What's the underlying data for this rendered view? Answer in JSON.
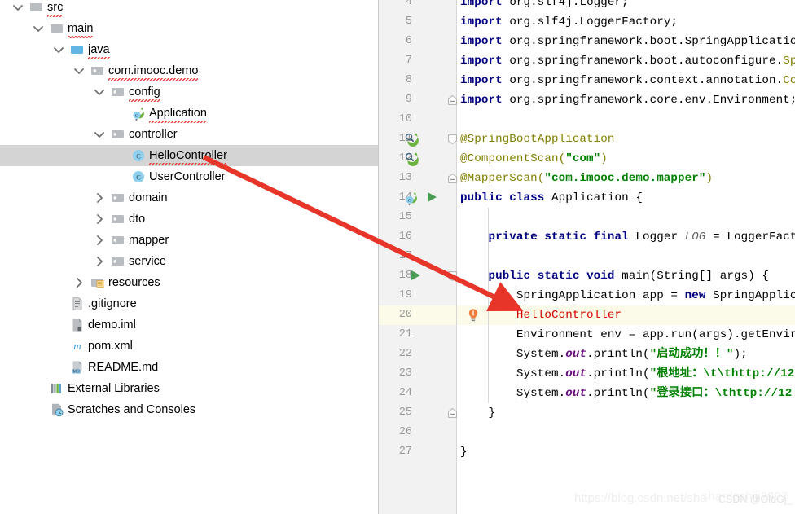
{
  "app": {
    "name": "IntelliJ IDEA",
    "view": "project-tree-and-editor"
  },
  "colors": {
    "selection": "#d4d4d4",
    "line_highlight": "#fcfae8",
    "arrow": "#e8352a",
    "keyword": "#000080",
    "annotation": "#808000",
    "string": "#008000",
    "field": "#660e7a",
    "error": "#d40000",
    "gutter_bg": "#f2f2f2",
    "line_number": "#999999",
    "spring_bean": "#6cb33f",
    "run_arrow": "#499c54",
    "folder": "#afb1b3",
    "java_folder": "#62b5e5",
    "class_icon": "#89c6e8",
    "bulb": "#e8a33d"
  },
  "tree": {
    "selected_item": "HelloController",
    "items": [
      {
        "label": "src",
        "indent": 0,
        "twisty": "down",
        "icon": "folder-plain-icon",
        "typo": true,
        "selected": false
      },
      {
        "label": "main",
        "indent": 1,
        "twisty": "down",
        "icon": "folder-plain-icon",
        "typo": true,
        "selected": false
      },
      {
        "label": "java",
        "indent": 2,
        "twisty": "down",
        "icon": "folder-java-icon",
        "typo": true,
        "selected": false
      },
      {
        "label": "com.imooc.demo",
        "indent": 3,
        "twisty": "down",
        "icon": "folder-package-icon",
        "typo": true,
        "selected": false
      },
      {
        "label": "config",
        "indent": 4,
        "twisty": "down",
        "icon": "folder-package-icon",
        "typo": true,
        "selected": false
      },
      {
        "label": "Application",
        "indent": 5,
        "twisty": "none",
        "icon": "spring-class-icon",
        "typo": true,
        "selected": false
      },
      {
        "label": "controller",
        "indent": 4,
        "twisty": "down",
        "icon": "folder-package-icon",
        "typo": false,
        "selected": false
      },
      {
        "label": "HelloController",
        "indent": 5,
        "twisty": "none",
        "icon": "class-icon",
        "typo": true,
        "selected": true
      },
      {
        "label": "UserController",
        "indent": 5,
        "twisty": "none",
        "icon": "class-icon",
        "typo": false,
        "selected": false
      },
      {
        "label": "domain",
        "indent": 4,
        "twisty": "right",
        "icon": "folder-package-icon",
        "typo": false,
        "selected": false
      },
      {
        "label": "dto",
        "indent": 4,
        "twisty": "right",
        "icon": "folder-package-icon",
        "typo": false,
        "selected": false
      },
      {
        "label": "mapper",
        "indent": 4,
        "twisty": "right",
        "icon": "folder-package-icon",
        "typo": false,
        "selected": false
      },
      {
        "label": "service",
        "indent": 4,
        "twisty": "right",
        "icon": "folder-package-icon",
        "typo": false,
        "selected": false
      },
      {
        "label": "resources",
        "indent": 3,
        "twisty": "right",
        "icon": "folder-resources-icon",
        "typo": false,
        "selected": false
      },
      {
        "label": ".gitignore",
        "indent": 2,
        "twisty": "none",
        "icon": "file-text-icon",
        "typo": false,
        "selected": false
      },
      {
        "label": "demo.iml",
        "indent": 2,
        "twisty": "none",
        "icon": "file-iml-icon",
        "typo": false,
        "selected": false
      },
      {
        "label": "pom.xml",
        "indent": 2,
        "twisty": "none",
        "icon": "maven-icon",
        "typo": false,
        "selected": false
      },
      {
        "label": "README.md",
        "indent": 2,
        "twisty": "none",
        "icon": "file-markdown-icon",
        "typo": false,
        "selected": false
      },
      {
        "label": "External Libraries",
        "indent": 1,
        "twisty": "none",
        "icon": "libraries-icon",
        "typo": false,
        "selected": false
      },
      {
        "label": "Scratches and Consoles",
        "indent": 1,
        "twisty": "none",
        "icon": "scratches-icon",
        "typo": false,
        "selected": false
      }
    ]
  },
  "editor": {
    "first_visible_line": 4,
    "last_visible_line": 27,
    "highlighted_line": 20,
    "lines": [
      {
        "n": 4,
        "tokens": [
          {
            "t": "import ",
            "c": "kw"
          },
          {
            "t": "org.slf4j.Logger;",
            "c": "plain"
          }
        ]
      },
      {
        "n": 5,
        "tokens": [
          {
            "t": "import ",
            "c": "kw"
          },
          {
            "t": "org.slf4j.LoggerFactory;",
            "c": "plain"
          }
        ]
      },
      {
        "n": 6,
        "tokens": [
          {
            "t": "import ",
            "c": "kw"
          },
          {
            "t": "org.springframework.boot.SpringApplication;",
            "c": "plain"
          }
        ]
      },
      {
        "n": 7,
        "tokens": [
          {
            "t": "import ",
            "c": "kw"
          },
          {
            "t": "org.springframework.boot.autoconfigure.",
            "c": "plain"
          },
          {
            "t": "Spri",
            "c": "ann"
          }
        ]
      },
      {
        "n": 8,
        "tokens": [
          {
            "t": "import ",
            "c": "kw"
          },
          {
            "t": "org.springframework.context.annotation.",
            "c": "plain"
          },
          {
            "t": "Comp",
            "c": "ann"
          }
        ]
      },
      {
        "n": 9,
        "tokens": [
          {
            "t": "import ",
            "c": "kw"
          },
          {
            "t": "org.springframework.core.env.Environment;",
            "c": "plain"
          }
        ]
      },
      {
        "n": 10,
        "tokens": []
      },
      {
        "n": 11,
        "tokens": [
          {
            "t": "@SpringBootApplication",
            "c": "ann"
          }
        ]
      },
      {
        "n": 12,
        "tokens": [
          {
            "t": "@ComponentScan(",
            "c": "ann"
          },
          {
            "t": "\"com\"",
            "c": "str"
          },
          {
            "t": ")",
            "c": "ann"
          }
        ]
      },
      {
        "n": 13,
        "tokens": [
          {
            "t": "@MapperScan(",
            "c": "ann"
          },
          {
            "t": "\"com.imooc.demo.mapper\"",
            "c": "str"
          },
          {
            "t": ")",
            "c": "ann"
          }
        ]
      },
      {
        "n": 14,
        "tokens": [
          {
            "t": "public class ",
            "c": "kw"
          },
          {
            "t": "Application {",
            "c": "plain"
          }
        ]
      },
      {
        "n": 15,
        "tokens": []
      },
      {
        "n": 16,
        "tokens": [
          {
            "t": "    ",
            "c": "plain"
          },
          {
            "t": "private static final ",
            "c": "kw"
          },
          {
            "t": "Logger ",
            "c": "plain"
          },
          {
            "t": "LOG",
            "c": "stat"
          },
          {
            "t": " = LoggerFact",
            "c": "plain"
          }
        ]
      },
      {
        "n": 17,
        "tokens": []
      },
      {
        "n": 18,
        "tokens": [
          {
            "t": "    ",
            "c": "plain"
          },
          {
            "t": "public static void ",
            "c": "kw"
          },
          {
            "t": "main(String[] args) {",
            "c": "plain"
          }
        ]
      },
      {
        "n": 19,
        "tokens": [
          {
            "t": "        SpringApplication app = ",
            "c": "plain"
          },
          {
            "t": "new ",
            "c": "kw"
          },
          {
            "t": "SpringApplicati",
            "c": "plain"
          }
        ]
      },
      {
        "n": 20,
        "tokens": [
          {
            "t": "        ",
            "c": "plain"
          },
          {
            "t": "HelloController",
            "c": "err"
          }
        ]
      },
      {
        "n": 21,
        "tokens": [
          {
            "t": "        Environment env = app.run(args).getEnvironm",
            "c": "plain"
          }
        ]
      },
      {
        "n": 22,
        "tokens": [
          {
            "t": "        System.",
            "c": "plain"
          },
          {
            "t": "out",
            "c": "fld"
          },
          {
            "t": ".println(",
            "c": "plain"
          },
          {
            "t": "\"启动成功！！\"",
            "c": "str"
          },
          {
            "t": ");",
            "c": "plain"
          }
        ]
      },
      {
        "n": 23,
        "tokens": [
          {
            "t": "        System.",
            "c": "plain"
          },
          {
            "t": "out",
            "c": "fld"
          },
          {
            "t": ".println(",
            "c": "plain"
          },
          {
            "t": "\"根地址：\\t\\thttp://12",
            "c": "str"
          }
        ]
      },
      {
        "n": 24,
        "tokens": [
          {
            "t": "        System.",
            "c": "plain"
          },
          {
            "t": "out",
            "c": "fld"
          },
          {
            "t": ".println(",
            "c": "plain"
          },
          {
            "t": "\"登录接口：\\thttp://12",
            "c": "str"
          }
        ]
      },
      {
        "n": 25,
        "tokens": [
          {
            "t": "    }",
            "c": "plain"
          }
        ]
      },
      {
        "n": 26,
        "tokens": []
      },
      {
        "n": 27,
        "tokens": [
          {
            "t": "}",
            "c": "plain"
          }
        ]
      }
    ],
    "gutter_icons": [
      {
        "line": 11,
        "icon": "spring-bean-icon"
      },
      {
        "line": 12,
        "icon": "spring-bean-icon"
      },
      {
        "line": 14,
        "icon": "spring-class-icon"
      },
      {
        "line": 14,
        "icon": "run-class-icon"
      },
      {
        "line": 18,
        "icon": "run-method-icon"
      },
      {
        "line": 20,
        "icon": "intention-bulb-icon"
      }
    ],
    "fold_markers": [
      {
        "line": 9,
        "type": "fold-end"
      },
      {
        "line": 11,
        "type": "fold-start"
      },
      {
        "line": 13,
        "type": "fold-end"
      },
      {
        "line": 18,
        "type": "fold-start"
      },
      {
        "line": 25,
        "type": "fold-end"
      }
    ]
  },
  "annotation": {
    "arrow_label": "arrow-from-HelloController-to-code",
    "from": "HelloController (project tree)",
    "to": "HelloController (line 20)"
  },
  "watermark": {
    "url": "https://blog.csdn.net/sha",
    "tag": "CSDN @OldGj_",
    "overlap": "shardgshiji2907"
  }
}
